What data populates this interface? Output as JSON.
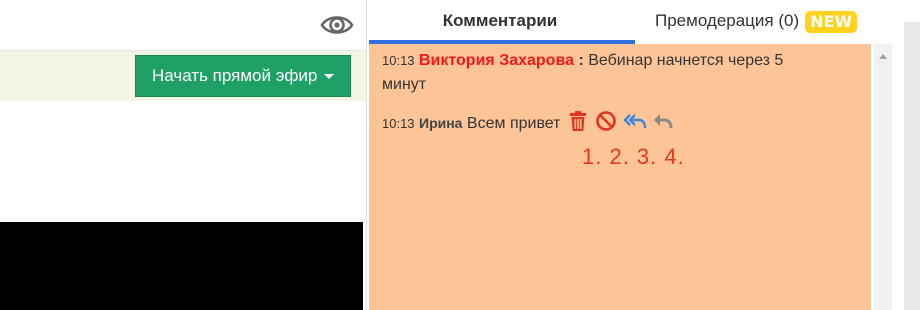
{
  "toolbar": {
    "eye_icon": "eye-icon",
    "live_button_label": "Начать прямой эфир",
    "live_button_color": "#1fa066"
  },
  "tabs": [
    {
      "label": "Комментарии",
      "active": true
    },
    {
      "label": "Премодерация (0)",
      "badge": "NEW",
      "active": false
    }
  ],
  "chat": {
    "background": "#fdc597",
    "messages": [
      {
        "time": "10:13",
        "author": "Виктория Захарова",
        "separator": ":",
        "text": "Вебинар начнется через 5 минут",
        "author_color": "#f01919"
      },
      {
        "time": "10:13",
        "author": "Ирина",
        "text": "Всем привет",
        "actions": [
          "delete-icon",
          "block-icon",
          "reply-all-icon",
          "reply-icon"
        ]
      }
    ],
    "annotation": "1. 2. 3. 4."
  }
}
